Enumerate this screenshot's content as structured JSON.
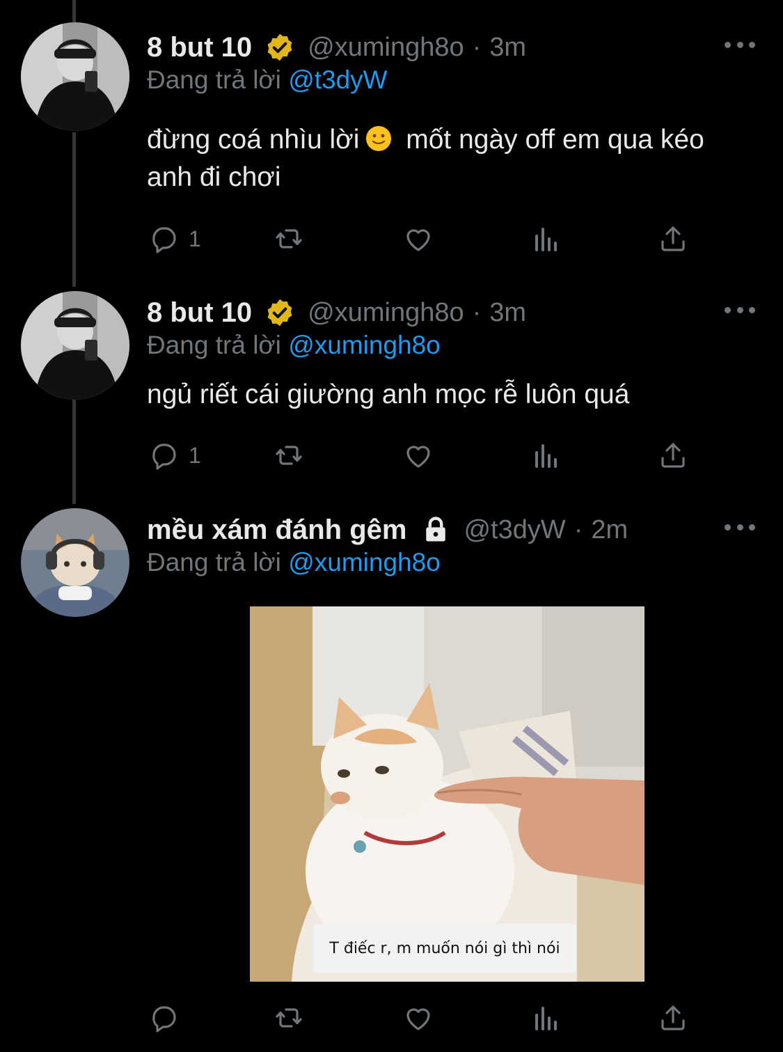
{
  "colors": {
    "background": "#000000",
    "text_primary": "#e7e9ea",
    "text_secondary": "#71767b",
    "mention": "#1d9bf0",
    "verified_gold": "#e2b719",
    "thread_line": "#333639"
  },
  "tweets": [
    {
      "name": "8 but 10",
      "badge": "verified-gold-icon",
      "handle": "@xumingh8o",
      "dot": "·",
      "time": "3m",
      "replying_prefix": "Đang trả lời",
      "replying_to": "@t3dyW",
      "text_part1": "đừng coá nhìu lời",
      "emoji": "slightly-smiling-face-emoji",
      "text_part2": "mốt ngày off em qua kéo anh đi chơi",
      "actions": {
        "reply_count": "1",
        "retweet_count": "",
        "like_count": "",
        "views_count": ""
      }
    },
    {
      "name": "8 but 10",
      "badge": "verified-gold-icon",
      "handle": "@xumingh8o",
      "dot": "·",
      "time": "3m",
      "replying_prefix": "Đang trả lời",
      "replying_to": "@xumingh8o",
      "text": "ngủ riết cái giường anh mọc rễ luôn quá",
      "actions": {
        "reply_count": "1",
        "retweet_count": "",
        "like_count": "",
        "views_count": ""
      }
    },
    {
      "name": "mều xám đánh gêm",
      "badge": "lock-icon",
      "handle": "@t3dyW",
      "dot": "·",
      "time": "2m",
      "replying_prefix": "Đang trả lời",
      "replying_to": "@xumingh8o",
      "media": {
        "caption": "T điếc r, m muốn nói gì thì nói"
      },
      "actions": {
        "reply_count": "",
        "retweet_count": "",
        "like_count": "",
        "views_count": ""
      }
    }
  ]
}
